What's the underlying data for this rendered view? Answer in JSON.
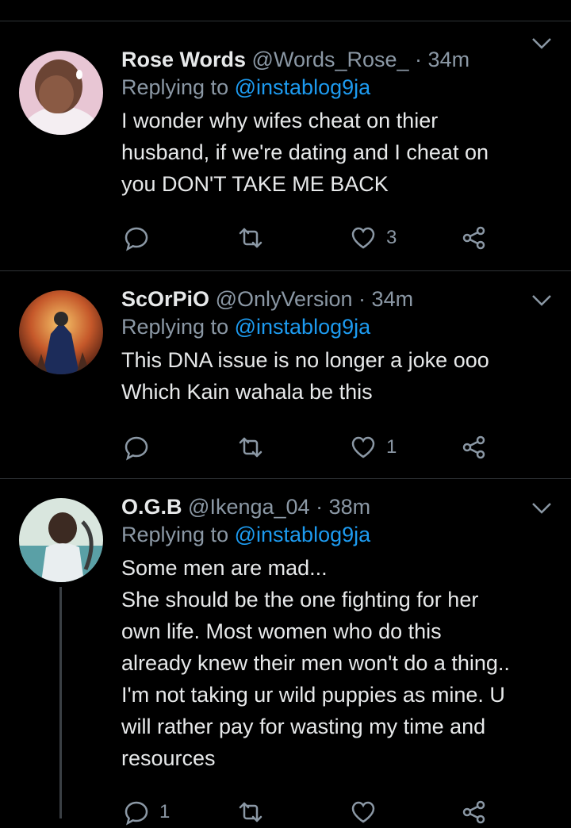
{
  "tweets": [
    {
      "name": "Rose Words",
      "handle": "@Words_Rose_",
      "time": "34m",
      "replying_prefix": "Replying to",
      "replying_to": "@instablog9ja",
      "text": "I wonder why wifes cheat on thier\nhusband, if we're dating and I cheat on\nyou DON'T TAKE ME BACK",
      "reply_count": "",
      "retweet_count": "",
      "like_count": "3"
    },
    {
      "name": "ScOrPiO",
      "handle": "@OnlyVersion",
      "time": "34m",
      "replying_prefix": "Replying to",
      "replying_to": "@instablog9ja",
      "text": "This DNA issue is no longer a joke ooo\nWhich Kain wahala be this",
      "reply_count": "",
      "retweet_count": "",
      "like_count": "1"
    },
    {
      "name": "O.G.B",
      "handle": "@Ikenga_04",
      "time": "38m",
      "replying_prefix": "Replying to",
      "replying_to": "@instablog9ja",
      "text": "Some men are mad...\nShe should be the one fighting for her\nown life. Most women who do this\nalready knew their men won't do a thing..\nI'm not taking ur wild puppies as mine. U\nwill rather pay for wasting my time and\nresources",
      "reply_count": "1",
      "retweet_count": "",
      "like_count": ""
    }
  ],
  "separator": " · ",
  "icons": {
    "reply": "reply-icon",
    "retweet": "retweet-icon",
    "like": "heart-icon",
    "share": "share-icon",
    "menu": "chevron-down-icon"
  },
  "colors": {
    "background": "#000000",
    "text": "#e7e9ea",
    "muted": "#8b98a5",
    "link": "#1d9bf0",
    "divider": "#2f3336"
  }
}
